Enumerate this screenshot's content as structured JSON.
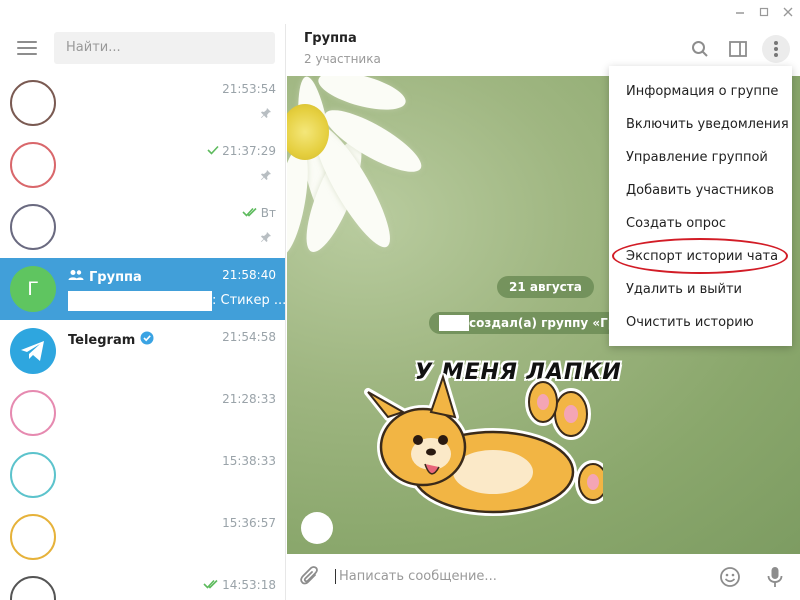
{
  "window": {
    "minimize_icon": "minimize-icon",
    "maximize_icon": "maximize-icon",
    "close_icon": "close-icon"
  },
  "sidebar": {
    "search_placeholder": "Найти...",
    "chats": [
      {
        "name": "",
        "time": "21:53:54",
        "pinned": true
      },
      {
        "name": "",
        "time": "21:37:29",
        "status": "read-single",
        "pinned": true
      },
      {
        "name": "",
        "time": "Вт",
        "status": "read-double",
        "pinned": true
      },
      {
        "name": "Группа",
        "time": "21:58:40",
        "avatar_letter": "Г",
        "preview": ": Стикер ...",
        "active": true,
        "is_group": true
      },
      {
        "name": "Telegram",
        "time": "21:54:58",
        "verified": true
      },
      {
        "name": "",
        "time": "21:28:33"
      },
      {
        "name": "",
        "time": "15:38:33"
      },
      {
        "name": "",
        "time": "15:36:57"
      },
      {
        "name": "",
        "time": "14:53:18",
        "status": "read-double"
      }
    ]
  },
  "header": {
    "title": "Группа",
    "subtitle": "2 участника"
  },
  "chat": {
    "date": "21 августа",
    "service_message": "создал(а) группу «Гр",
    "sticker_text": "У МЕНЯ ЛАПКИ"
  },
  "input": {
    "placeholder": "Написать сообщение..."
  },
  "menu": {
    "items": [
      "Информация о группе",
      "Включить уведомления",
      "Управление группой",
      "Добавить участников",
      "Создать опрос",
      "Экспорт истории чата",
      "Удалить и выйти",
      "Очистить историю"
    ],
    "highlighted_index": 5
  },
  "colors": {
    "accent": "#419fd9",
    "group_avatar": "#5fc560",
    "telegram_avatar": "#2ea6df",
    "highlight_ring": "#d21c26",
    "read_check": "#5ebb5e"
  }
}
